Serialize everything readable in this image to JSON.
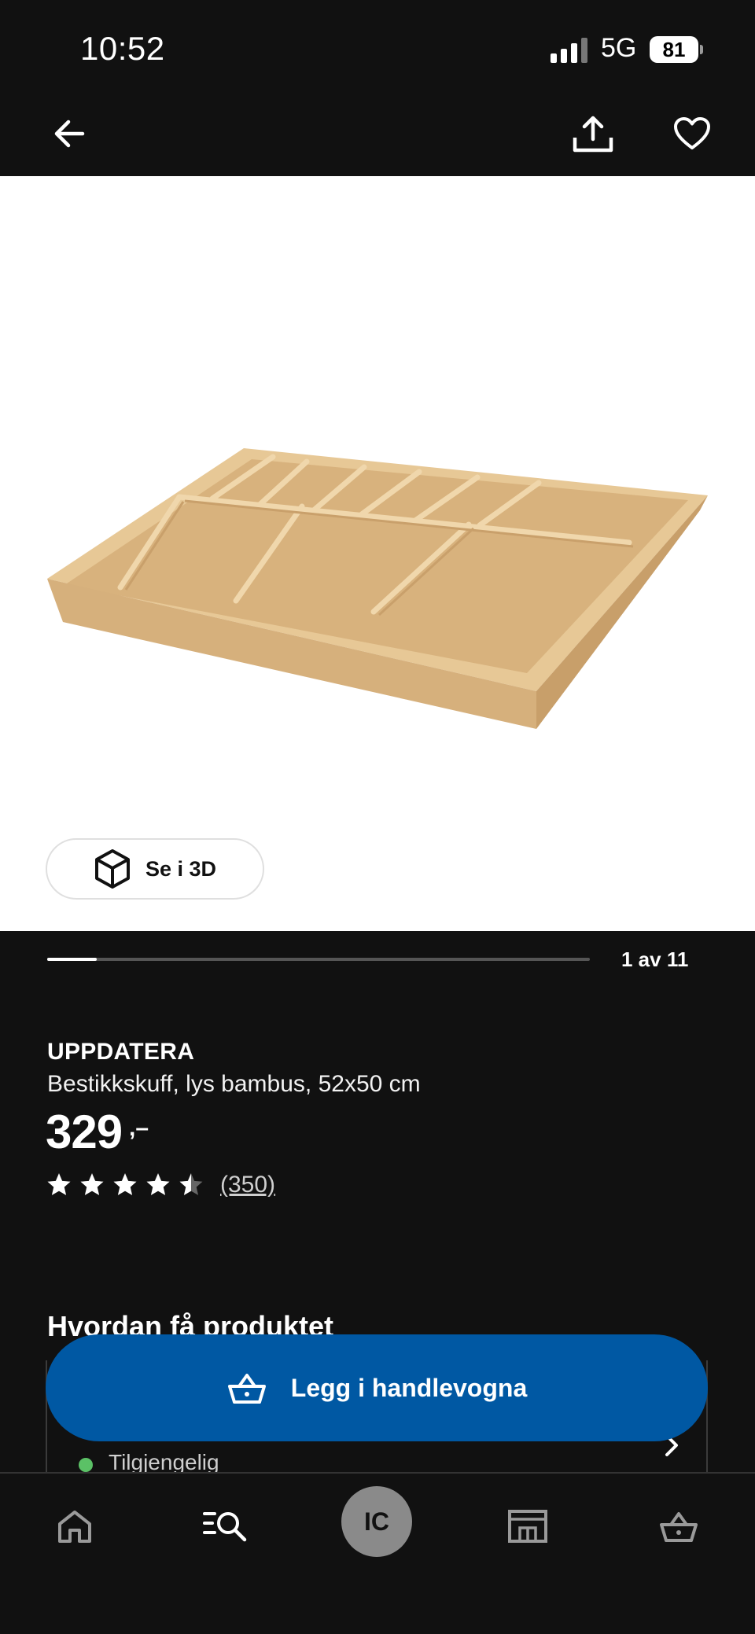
{
  "status_bar": {
    "time": "10:52",
    "network": "5G",
    "battery": "81",
    "icons": [
      "signal-icon",
      "battery-icon"
    ]
  },
  "top_nav": {
    "icons": [
      "back-arrow-icon",
      "share-icon",
      "heart-icon"
    ]
  },
  "gallery": {
    "view_3d_label": "Se i 3D",
    "view_3d_icon": "cube-icon",
    "position_label": "1 av 11",
    "current_image": 1,
    "total_images": 11
  },
  "product": {
    "name": "UPPDATERA",
    "description": "Bestikkskuff, lys bambus, 52x50 cm",
    "price": "329",
    "price_suffix": ",–",
    "rating": 4.5,
    "rating_max": 5,
    "review_count": "(350)"
  },
  "delivery": {
    "section_title": "Hvordan få produktet",
    "availability_text": "Tilgjengelig",
    "availability_color": "#5bc166"
  },
  "cta": {
    "add_to_cart_label": "Legg i handlevogna",
    "icon": "basket-icon",
    "color": "#0058a3"
  },
  "bottom_nav": {
    "items": [
      "home-icon",
      "search-list-icon",
      "profile-avatar",
      "store-icon",
      "basket-icon"
    ],
    "avatar_initials": "IC"
  }
}
